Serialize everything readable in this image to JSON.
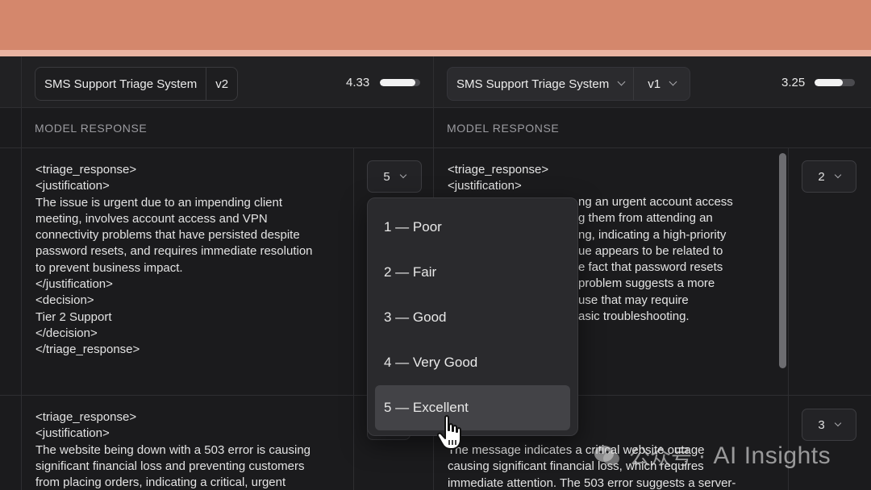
{
  "left_panel": {
    "system_select": "SMS Support Triage System",
    "version_select": "v2",
    "score": "4.33",
    "score_fraction": 0.87,
    "section_label": "MODEL RESPONSE",
    "responses": [
      {
        "text": "<triage_response>\n<justification>\nThe issue is urgent due to an impending client\nmeeting, involves account access and VPN\nconnectivity problems that have persisted despite\npassword resets, and requires immediate resolution\nto prevent business impact.\n</justification>\n<decision>\nTier 2 Support\n</decision>\n</triage_response>",
        "rating": "5"
      },
      {
        "text": "<triage_response>\n<justification>\nThe website being down with a 503 error is causing\nsignificant financial loss and preventing customers\nfrom placing orders, indicating a critical, urgent",
        "rating": ""
      }
    ]
  },
  "right_panel": {
    "system_select": "SMS Support Triage System",
    "version_select": "v1",
    "score": "3.25",
    "score_fraction": 0.7,
    "section_label": "MODEL RESPONSE",
    "responses": [
      {
        "line1": "<triage_response>",
        "line2": "<justification>",
        "visible_lines": [
          "ng an urgent account access",
          "g them from attending an",
          "ng, indicating a high-priority",
          "ue appears to be related to",
          "e fact that password resets",
          "problem suggests a more",
          "use that may require",
          "asic troubleshooting."
        ],
        "rating": "2"
      },
      {
        "visible_lines": [
          "The message indicates a critical website outage",
          "causing significant financial loss, which requires",
          "immediate attention. The 503 error suggests a server-"
        ],
        "rating": "3"
      }
    ]
  },
  "rating_dropdown": {
    "options": [
      "1 — Poor",
      "2 — Fair",
      "3 — Good",
      "4 — Very Good",
      "5 — Excellent"
    ],
    "selected_index": 4
  },
  "watermark": {
    "cn": "公众号 ·",
    "en": "AI Insights"
  },
  "colors": {
    "top_band": "#d4876c",
    "background": "#1b1b1d",
    "selected_option": "#434347"
  },
  "icons": [
    "chevron-down-icon",
    "hand-pointer-cursor-icon",
    "wechat-icon"
  ]
}
